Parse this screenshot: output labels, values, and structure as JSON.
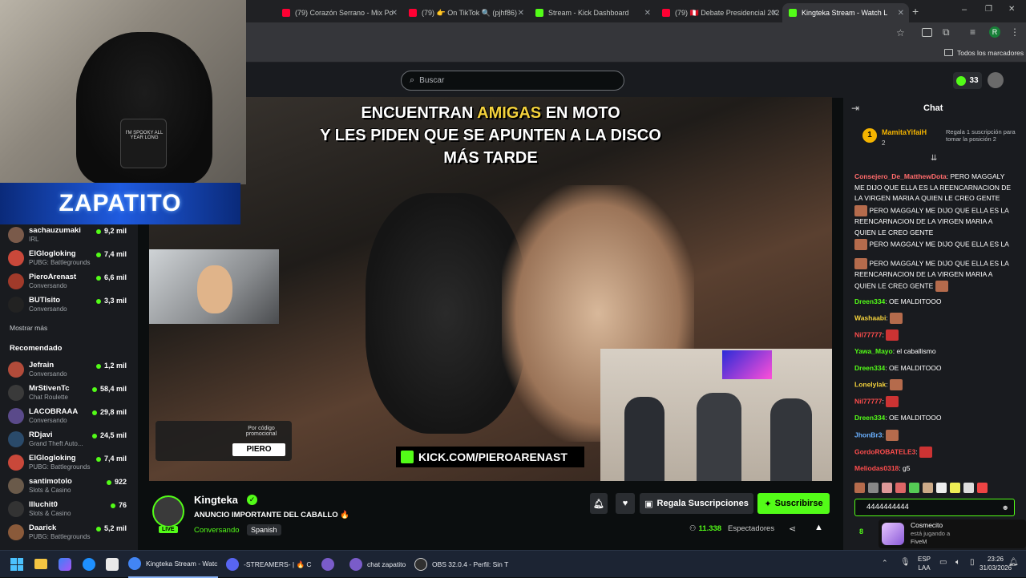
{
  "browser": {
    "tabs": [
      {
        "label": "(79) Corazón Serrano - Mix Po",
        "fav": "#ff0033"
      },
      {
        "label": "(79) 👉 On TikTok 🔍 (pjhf86)",
        "fav": "#ff0033"
      },
      {
        "label": "Stream - Kick Dashboard",
        "fav": "#53fc18"
      },
      {
        "label": "(79) 🇵🇪 Debate Presidencial 202",
        "fav": "#ff0033"
      },
      {
        "label": "Kingteka Stream - Watch L",
        "fav": "#53fc18"
      }
    ],
    "bookmarks_label": "Todos los marcadores"
  },
  "topnav": {
    "search_placeholder": "Buscar",
    "kicks_count": "33"
  },
  "sidebar": {
    "channels": [
      {
        "name": "sachauzumaki",
        "category": "IRL",
        "viewers": "9,2 mil",
        "color": "#7a5a4a"
      },
      {
        "name": "ElGlogloking",
        "category": "PUBG: Battlegrounds",
        "viewers": "7,4 mil",
        "color": "#c9483a"
      },
      {
        "name": "PieroArenast",
        "category": "Conversando",
        "viewers": "6,6 mil",
        "color": "#a13a2a"
      },
      {
        "name": "BUTIsito",
        "category": "Conversando",
        "viewers": "3,3 mil",
        "color": "#222"
      }
    ],
    "show_more": "Mostrar más",
    "recommended_title": "Recomendado",
    "recommended": [
      {
        "name": "Jefrain",
        "category": "Conversando",
        "viewers": "1,2 mil",
        "color": "#b24b3a"
      },
      {
        "name": "MrStivenTc",
        "category": "Chat Roulette",
        "viewers": "58,4 mil",
        "color": "#3a3a3a"
      },
      {
        "name": "LACOBRAAA",
        "category": "Conversando",
        "viewers": "29,8 mil",
        "color": "#5a4a8a"
      },
      {
        "name": "RDjavi",
        "category": "Grand Theft Auto...",
        "viewers": "24,5 mil",
        "color": "#2a4a6a"
      },
      {
        "name": "ElGlogloking",
        "category": "PUBG: Battlegrounds",
        "viewers": "7,4 mil",
        "color": "#c9483a"
      },
      {
        "name": "santimotolo",
        "category": "Slots & Casino",
        "viewers": "922",
        "color": "#6a5a4a"
      },
      {
        "name": "Illuchit0",
        "category": "Slots & Casino",
        "viewers": "76",
        "color": "#333"
      },
      {
        "name": "Daarick",
        "category": "PUBG: Battlegrounds",
        "viewers": "5,2 mil",
        "color": "#8a5a3a"
      }
    ]
  },
  "overlay": {
    "webcam_name": "ZAPATITO",
    "mug_text": "I'M SPOOKY ALL YEAR LONG"
  },
  "player": {
    "caption_line1_a": "ENCUENTRAN ",
    "caption_line1_b": "AMIGAS",
    "caption_line1_c": " EN MOTO",
    "caption_line2": "Y LES PIDEN QUE SE APUNTEN A LA DISCO",
    "caption_line3": "MÁS TARDE",
    "promo_label": "Por código promocional",
    "promo_code": "PIERO",
    "kick_url": "KICK.COM/PIEROARENAST"
  },
  "stream": {
    "streamer": "Kingteka",
    "title": "ANUNCIO IMPORTANTE DEL CABALLO 🔥",
    "category": "Conversando",
    "language": "Spanish",
    "live_badge": "LIVE",
    "viewers": "11.338",
    "viewers_label": "Espectadores",
    "gift_button": "Regala Suscripciones",
    "subscribe_button": "Suscribirse"
  },
  "chat": {
    "title": "Chat",
    "pinned_user": "MamitaYifaiH",
    "pinned_rank": "1",
    "pinned_count": "2",
    "pinned_text": "Regala 1 suscripción para tomar la posición 2",
    "messages": [
      {
        "user": "Consejero_De_MatthewDota",
        "color": "#ff6b6b",
        "text": "PERO MAGGALY ME DIJO QUE ELLA ES LA REENCARNACION DE LA VIRGEN MARIA A QUIEN LE CREO GENTE"
      },
      {
        "user": "",
        "color": "#fff",
        "text": "PERO MAGGALY ME DIJO QUE ELLA ES LA REENCARNACION DE LA VIRGEN MARIA A QUIEN LE CREO GENTE"
      },
      {
        "user": "",
        "color": "#fff",
        "text": "PERO MAGGALY ME DIJO QUE ELLA ES LA REENCARNACION DE LA VIRGEN MARIA A QUIEN LE CREO GENTE"
      },
      {
        "user": "",
        "color": "#fff",
        "text": "PERO MAGGALY ME DIJO QUE ELLA ES LA REENCARNACION DE LA VIRGEN MARIA A QUIEN LE CREO GENTE"
      },
      {
        "user": "Dreen334",
        "color": "#53fc18",
        "text": "OE MALDITOOO"
      },
      {
        "user": "Washaabi",
        "color": "#f4d23c",
        "text": ""
      },
      {
        "user": "Nil77777",
        "color": "#ff4d4d",
        "text": ""
      },
      {
        "user": "Yawa_Mayo",
        "color": "#53fc18",
        "text": "el caballismo"
      },
      {
        "user": "Dreen334",
        "color": "#53fc18",
        "text": "OE MALDITOOO"
      },
      {
        "user": "Lonelylak",
        "color": "#f4d23c",
        "text": ""
      },
      {
        "user": "Nil77777",
        "color": "#ff4d4d",
        "text": ""
      },
      {
        "user": "Dreen334",
        "color": "#53fc18",
        "text": "OE MALDITOOO"
      },
      {
        "user": "JhonBr3",
        "color": "#6ab0ff",
        "text": ""
      },
      {
        "user": "GordoROBATELE3",
        "color": "#ff4d4d",
        "text": ""
      },
      {
        "user": "Meliodas0318",
        "color": "#ff4d4d",
        "text": "g5"
      }
    ],
    "input_value": "4444444444",
    "notif_user": "Cosmecito",
    "notif_text": "está jugando a",
    "notif_game": "FiveM",
    "points": "8"
  },
  "taskbar": {
    "items": [
      {
        "label": "Kingteka Stream - Watc",
        "color": "#4285f4"
      },
      {
        "label": "-STREAMERS- | 🔥 C",
        "color": "#5865f2"
      },
      {
        "label": "chat zapatito",
        "color": "#7a5cc9"
      },
      {
        "label": "OBS 32.0.4 - Perfil: Sin T",
        "color": "#303030"
      }
    ],
    "lang": "ESP",
    "lang2": "LAA",
    "time": "23:26",
    "date": "31/03/2026"
  },
  "colors": {
    "kick_green": "#53fc18",
    "bg": "#0b0e0f",
    "panel": "#191b1f"
  }
}
